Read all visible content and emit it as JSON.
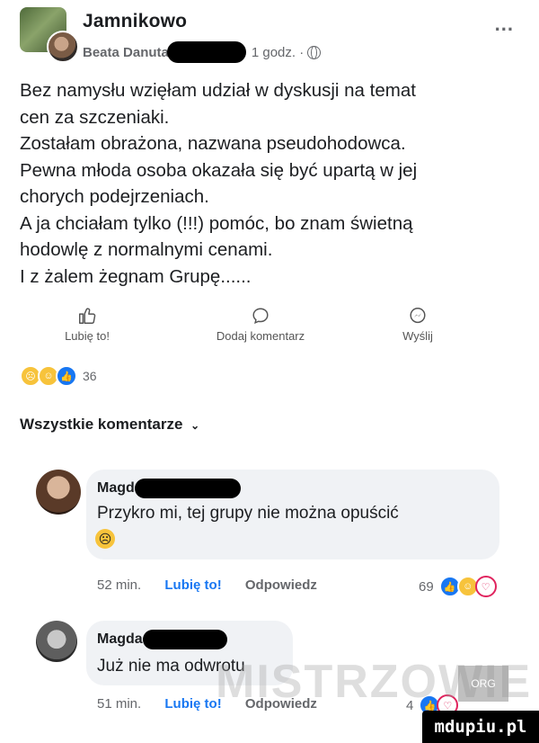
{
  "post": {
    "group_name": "Jamnikowo",
    "author": "Beata Danuta",
    "time": "1 godz. ·",
    "more_label": "...",
    "lines": [
      "Bez namysłu wzięłam udział w dyskusji na temat",
      "cen za szczeniaki.",
      "Zostałam obrażona, nazwana pseudohodowca.",
      "Pewna młoda osoba okazała się być upartą w jej",
      "chorych podejrzeniach.",
      "A ja chciałam tylko (!!!) pomóc, bo znam świetną",
      "hodowlę z normalnymi cenami.",
      "I z żalem żegnam Grupę......"
    ]
  },
  "actions": {
    "like": "Lubię to!",
    "comment": "Dodaj komentarz",
    "send": "Wyślij"
  },
  "reactions": {
    "count": "36",
    "icons": [
      "sad-reaction-icon",
      "haha-reaction-icon",
      "like-reaction-icon"
    ]
  },
  "all_comments_label": "Wszystkie komentarze",
  "comments": [
    {
      "name": "Magd",
      "text": "Przykro mi, tej grupy nie można opuścić",
      "time": "52 min.",
      "like_label": "Lubię to!",
      "reply_label": "Odpowiedz",
      "reaction_count": "69"
    },
    {
      "name": "Magda",
      "text": "Już nie ma odwrotu",
      "time": "51 min.",
      "like_label": "Lubię to!",
      "reply_label": "Odpowiedz",
      "reaction_count": "4"
    }
  ],
  "watermark": {
    "text": "MISTRZOWIE",
    "badge": "ORG"
  },
  "site_badge": "mdupiu.pl",
  "colors": {
    "accent": "#1877f2",
    "muted": "#65676b",
    "bubble": "#f0f2f5"
  }
}
